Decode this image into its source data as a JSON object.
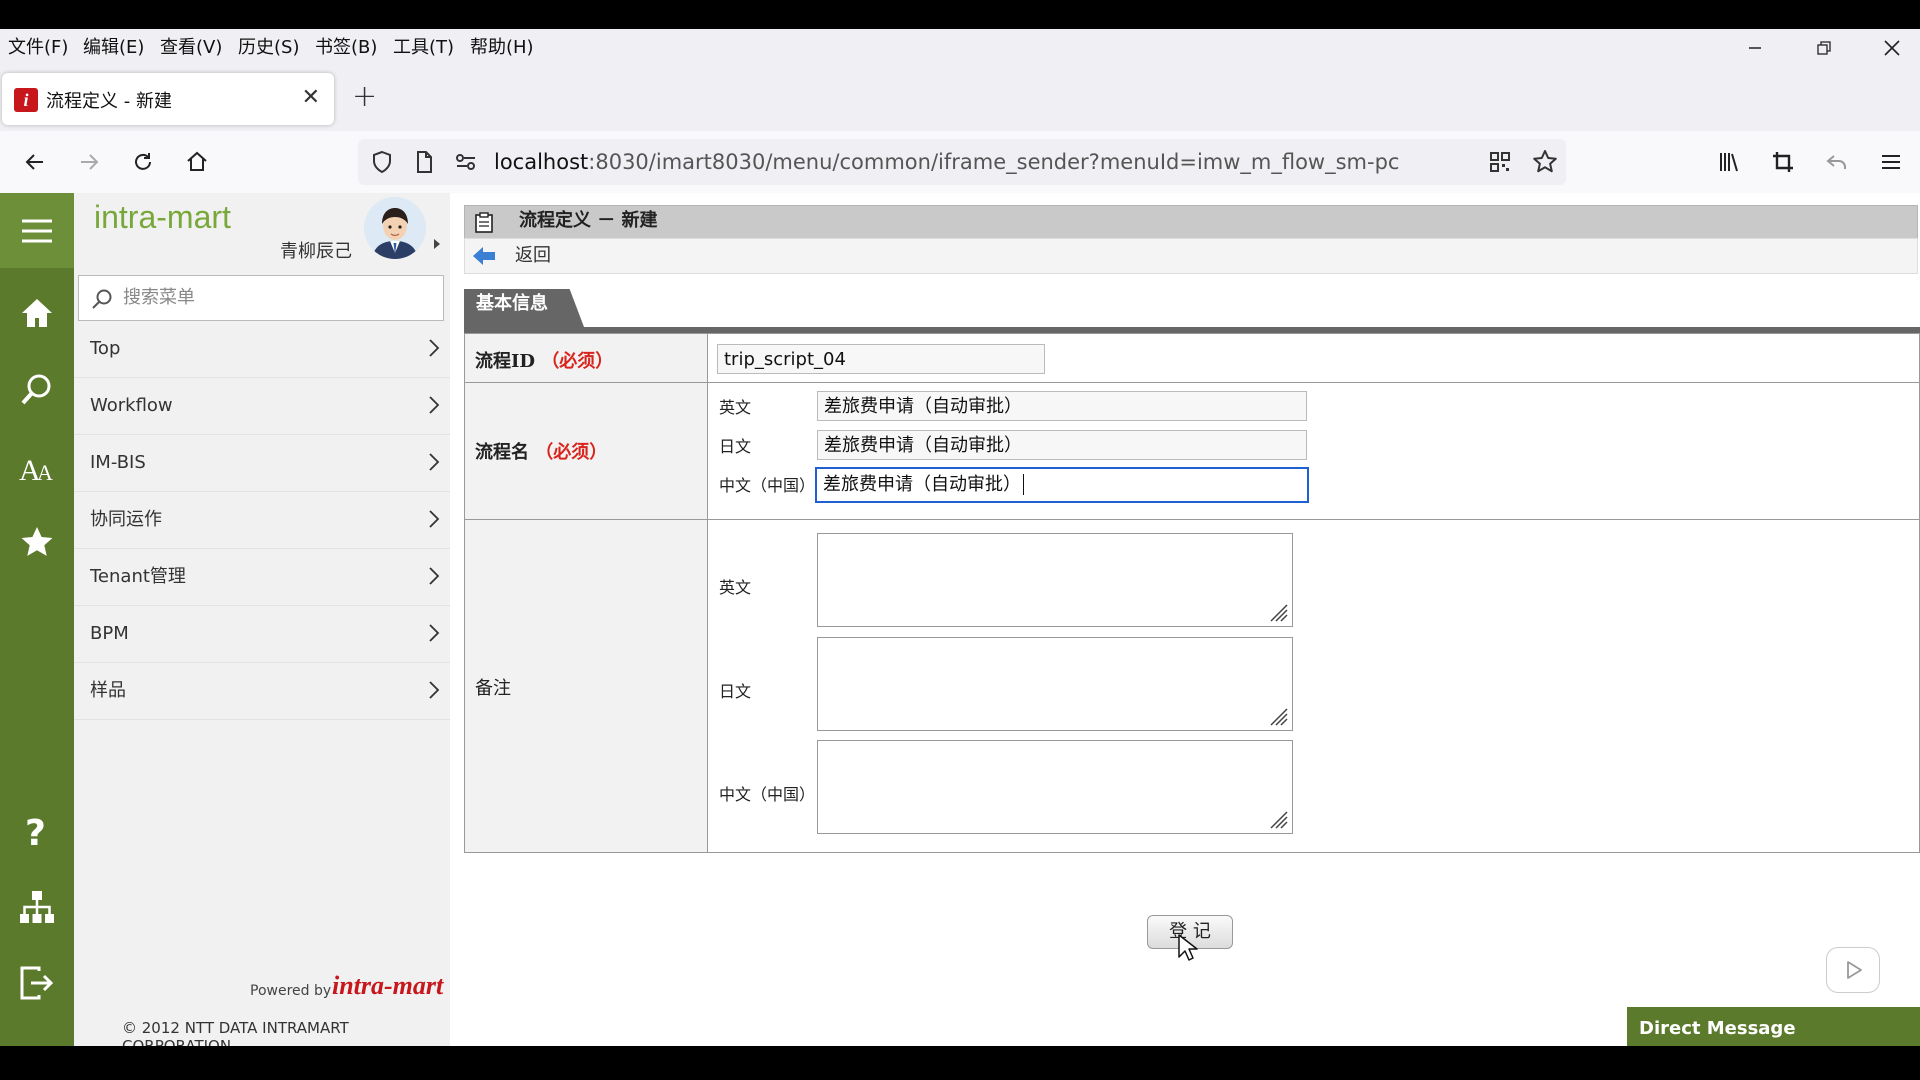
{
  "menubar": {
    "items": [
      "文件(F)",
      "编辑(E)",
      "查看(V)",
      "历史(S)",
      "书签(B)",
      "工具(T)",
      "帮助(H)"
    ]
  },
  "tab": {
    "title": "流程定义 - 新建"
  },
  "address": {
    "host": "localhost",
    "rest": ":8030/imart8030/menu/common/iframe_sender?menuId=imw_m_flow_sm-pc"
  },
  "sidebar": {
    "logo": "intra-mart",
    "user_name": "青柳辰己",
    "search_placeholder": "搜索菜单",
    "items": [
      {
        "label": "Top"
      },
      {
        "label": "Workflow"
      },
      {
        "label": "IM-BIS"
      },
      {
        "label": "协同运作"
      },
      {
        "label": "Tenant管理"
      },
      {
        "label": "BPM"
      },
      {
        "label": "样品"
      }
    ],
    "powered_by": "Powered by",
    "brand": "intra-mart",
    "copyright": "© 2012 NTT DATA INTRAMART CORPORATION"
  },
  "page": {
    "title": "流程定义 － 新建",
    "back_label": "返回",
    "section_tab": "基本信息",
    "flow_id": {
      "label": "流程ID",
      "required": "（必须）",
      "value": "trip_script_04"
    },
    "flow_name": {
      "label": "流程名",
      "required": "（必须）",
      "langs": [
        {
          "label": "英文",
          "value": "差旅费申请（自动审批）"
        },
        {
          "label": "日文",
          "value": "差旅费申请（自动审批）"
        },
        {
          "label": "中文（中国）",
          "value": "差旅费申请（自动审批）"
        }
      ]
    },
    "remarks": {
      "label": "备注",
      "langs": [
        {
          "label": "英文",
          "value": ""
        },
        {
          "label": "日文",
          "value": ""
        },
        {
          "label": "中文（中国）",
          "value": ""
        }
      ]
    },
    "register_label": "登 记",
    "direct_message": "Direct Message"
  },
  "colors": {
    "rail": "#5b7a2c",
    "required": "#d9241d",
    "focus": "#1f5fd0"
  }
}
